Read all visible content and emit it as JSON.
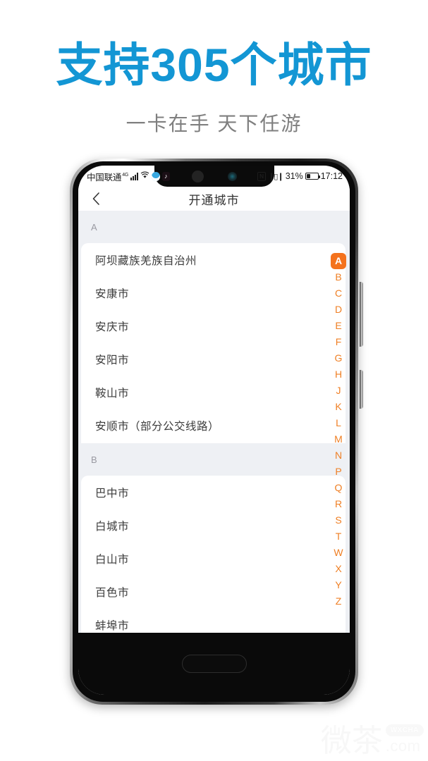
{
  "promo": {
    "headline": "支持305个城市",
    "subtitle": "一卡在手 天下任游",
    "headline_color": "#1396d4",
    "subtitle_color": "#7f7f7f"
  },
  "status_bar": {
    "carrier": "中国联通",
    "network": "4G",
    "signal_icon": "signal-bars-icon",
    "wifi_icon": "wifi-icon",
    "app_icon_1": "blue-circle-app-icon",
    "app_icon_2": "douyin-app-icon",
    "douyin_glyph": "♪",
    "nfc_label": "N",
    "nfc_icon": "nfc-icon",
    "vibrate_icon": "vibrate-icon",
    "vibrate_glyph": "❙▯❙",
    "battery_percent": "31%",
    "battery_icon": "battery-icon",
    "time": "17:12"
  },
  "navbar": {
    "back_icon": "back-chevron-icon",
    "back_glyph": "‹",
    "title": "开通城市"
  },
  "index_bar": {
    "active": "A",
    "letters": [
      "A",
      "B",
      "C",
      "D",
      "E",
      "F",
      "G",
      "H",
      "J",
      "K",
      "L",
      "M",
      "N",
      "P",
      "Q",
      "R",
      "S",
      "T",
      "W",
      "X",
      "Y",
      "Z"
    ],
    "active_bg": "#f4721d",
    "letter_color": "#ef7f24"
  },
  "sections": [
    {
      "letter": "A",
      "cities": [
        "阿坝藏族羌族自治州",
        "安康市",
        "安庆市",
        "安阳市",
        "鞍山市",
        "安顺市（部分公交线路）"
      ]
    },
    {
      "letter": "B",
      "cities": [
        "巴中市",
        "白城市",
        "白山市",
        "百色市",
        "蚌埠市"
      ]
    }
  ],
  "device": {
    "home_button": "home-button",
    "notch": "camera-notch"
  },
  "watermark": {
    "cn": "微茶",
    "badge": "WXCHA",
    "domain": ".com"
  }
}
